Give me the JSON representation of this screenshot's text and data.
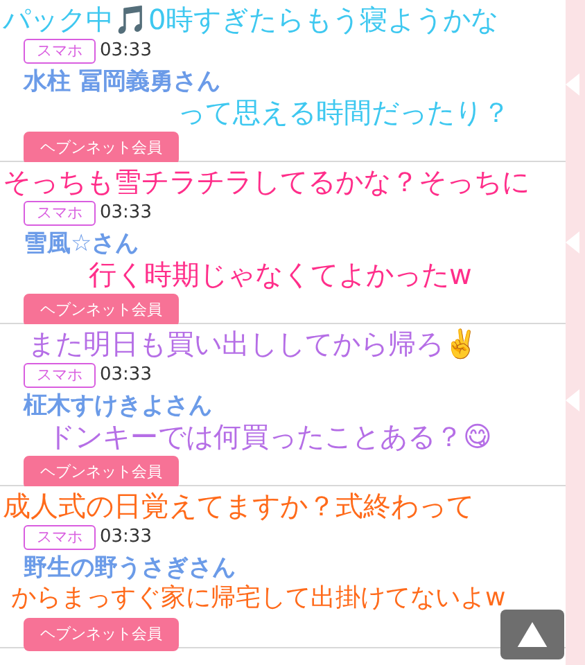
{
  "posts": [
    {
      "badge": "スマホ",
      "time": "03:33",
      "name": "水柱 冨岡義勇さん",
      "member_button": "ヘブンネット会員",
      "comment": {
        "color": "#3ec8f0",
        "lines": [
          "パック中🎵0時すぎたらもう寝ようかな",
          "って思える時間だったり？"
        ]
      }
    },
    {
      "badge": "スマホ",
      "time": "03:33",
      "name": "雪風☆さん",
      "member_button": "ヘブンネット会員",
      "comment": {
        "color": "#ff2e8a",
        "lines": [
          "そっちも雪チラチラしてるかな？そっちに",
          "行く時期じゃなくてよかったw"
        ]
      }
    },
    {
      "badge": "スマホ",
      "time": "03:33",
      "name": "柾木すけきよさん",
      "member_button": "ヘブンネット会員",
      "comment": {
        "color": "#b56ee6",
        "lines": [
          "また明日も買い出ししてから帰ろ✌️",
          "ドンキーでは何買ったことある？😋"
        ]
      }
    },
    {
      "badge": "スマホ",
      "time": "03:33",
      "name": "野生の野うさぎさん",
      "member_button": "ヘブンネット会員",
      "comment": {
        "color": "#ff6a1a",
        "lines": [
          "成人式の日覚えてますか？式終わって",
          "からまっすぐ家に帰宅して出掛けてないよw"
        ]
      }
    }
  ]
}
